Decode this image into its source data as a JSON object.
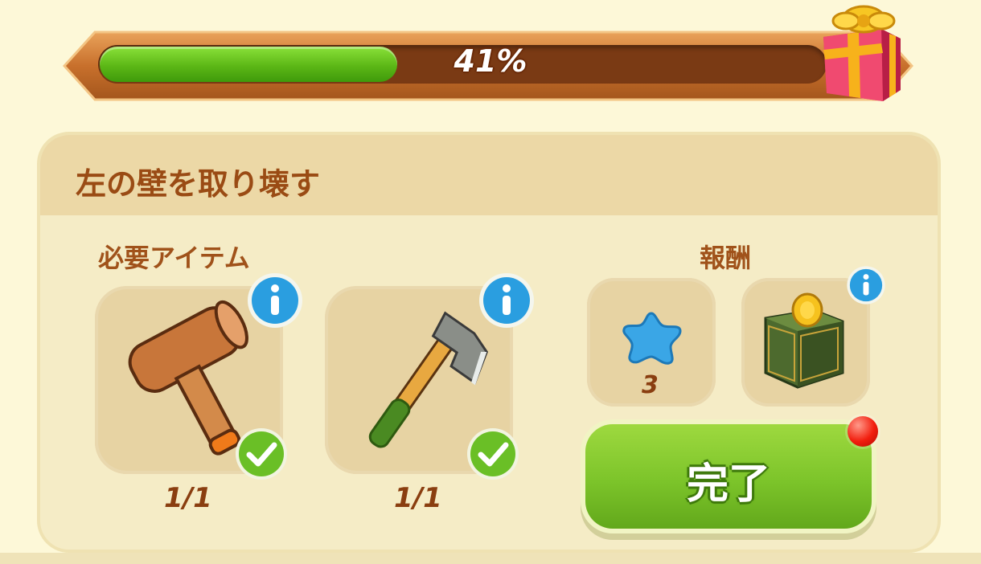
{
  "progress": {
    "percent": 41,
    "label": "41%"
  },
  "task": {
    "title": "左の壁を取り壊す"
  },
  "required": {
    "heading": "必要アイテム",
    "items": [
      {
        "name": "mallet",
        "count": "1/1",
        "complete": true
      },
      {
        "name": "axe",
        "count": "1/1",
        "complete": true
      }
    ]
  },
  "rewards": {
    "heading": "報酬",
    "items": [
      {
        "name": "blue-star",
        "count": "3"
      },
      {
        "name": "coin-box",
        "count": ""
      }
    ]
  },
  "complete_button": {
    "label": "完了"
  },
  "colors": {
    "accent_green": "#7cc42a",
    "title_brown": "#9a4b14",
    "info_blue": "#2a9ee0"
  }
}
